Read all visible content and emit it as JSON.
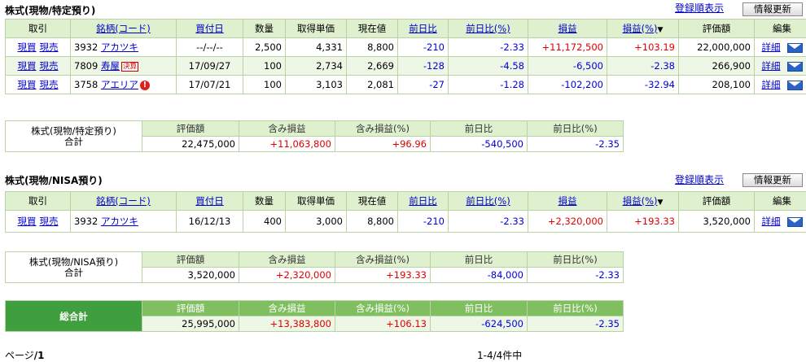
{
  "section1": {
    "title": "株式(現物/特定預り)",
    "sort_link": "登録順表示",
    "refresh_button": "情報更新",
    "headers": [
      "取引",
      "銘柄(コード)",
      "買付日",
      "数量",
      "取得単価",
      "現在値",
      "前日比",
      "前日比(%)",
      "損益",
      "損益(%)",
      "評価額",
      "編集"
    ],
    "sort_arrow": "▼",
    "trade_buy": "現買",
    "trade_sell": "現売",
    "detail_label": "詳細",
    "rows": [
      {
        "code": "3932",
        "name": "アカツキ",
        "date": "--/--/--",
        "qty": "2,500",
        "cost": "4,331",
        "price": "8,800",
        "chg": "-210",
        "chg_pct": "-2.33",
        "pl": "+11,172,500",
        "pl_pct": "+103.19",
        "value": "22,000,000"
      },
      {
        "code": "7809",
        "name": "寿屋",
        "badge": "決算",
        "date": "17/09/27",
        "qty": "100",
        "cost": "2,734",
        "price": "2,669",
        "chg": "-128",
        "chg_pct": "-4.58",
        "pl": "-6,500",
        "pl_pct": "-2.38",
        "value": "266,900"
      },
      {
        "code": "3758",
        "name": "アエリア",
        "alert": "!",
        "date": "17/07/21",
        "qty": "100",
        "cost": "3,103",
        "price": "2,081",
        "chg": "-27",
        "chg_pct": "-1.28",
        "pl": "-102,200",
        "pl_pct": "-32.94",
        "value": "208,100"
      }
    ],
    "summary": {
      "label_line1": "株式(現物/特定預り)",
      "label_line2": "合計",
      "headers": [
        "評価額",
        "含み損益",
        "含み損益(%)",
        "前日比",
        "前日比(%)"
      ],
      "values": [
        "22,475,000",
        "+11,063,800",
        "+96.96",
        "-540,500",
        "-2.35"
      ]
    }
  },
  "section2": {
    "title": "株式(現物/NISA預り)",
    "sort_link": "登録順表示",
    "refresh_button": "情報更新",
    "headers": [
      "取引",
      "銘柄(コード)",
      "買付日",
      "数量",
      "取得単価",
      "現在値",
      "前日比",
      "前日比(%)",
      "損益",
      "損益(%)",
      "評価額",
      "編集"
    ],
    "sort_arrow": "▼",
    "trade_buy": "現買",
    "trade_sell": "現売",
    "detail_label": "詳細",
    "rows": [
      {
        "code": "3932",
        "name": "アカツキ",
        "date": "16/12/13",
        "qty": "400",
        "cost": "3,000",
        "price": "8,800",
        "chg": "-210",
        "chg_pct": "-2.33",
        "pl": "+2,320,000",
        "pl_pct": "+193.33",
        "value": "3,520,000"
      }
    ],
    "summary": {
      "label_line1": "株式(現物/NISA預り)",
      "label_line2": "合計",
      "headers": [
        "評価額",
        "含み損益",
        "含み損益(%)",
        "前日比",
        "前日比(%)"
      ],
      "values": [
        "3,520,000",
        "+2,320,000",
        "+193.33",
        "-84,000",
        "-2.33"
      ]
    }
  },
  "grand_total": {
    "label": "総合計",
    "headers": [
      "評価額",
      "含み損益",
      "含み損益(%)",
      "前日比",
      "前日比(%)"
    ],
    "values": [
      "25,995,000",
      "+13,383,800",
      "+106.13",
      "-624,500",
      "-2.35"
    ]
  },
  "footer": {
    "page_label": "ページ",
    "page_value": "/1",
    "count": "1-4/4件中"
  },
  "colors": {
    "header_bg": "#dff0cf",
    "row_alt_bg": "#eef6e5",
    "border": "#b9d3a4",
    "positive": "#e00000",
    "negative": "#0000dd",
    "link": "#0000cc",
    "total_label_bg": "#3f9f3f"
  }
}
